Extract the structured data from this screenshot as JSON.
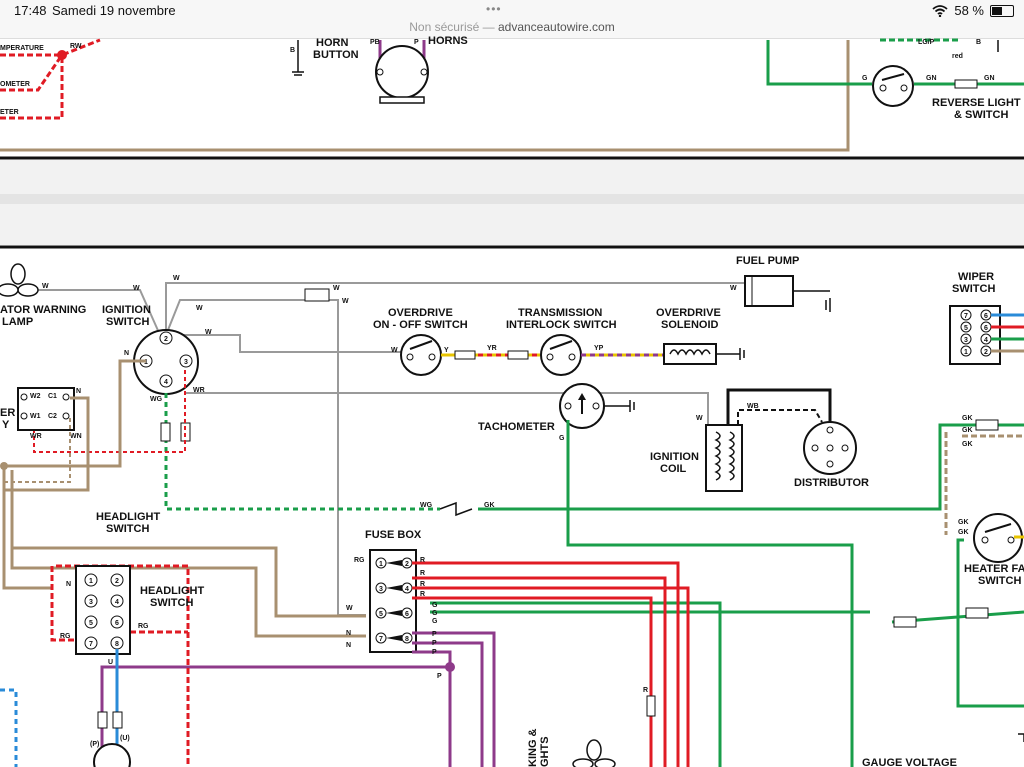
{
  "status_bar": {
    "time": "17:48",
    "date": "Samedi 19 novembre",
    "dots": "•••",
    "not_secure": "Non sécurisé —",
    "url": "advanceautowire.com",
    "battery": "58 %",
    "battery_level": 0.58,
    "wifi_icon": "wifi-icon",
    "battery_icon": "battery-icon"
  },
  "diagram": {
    "top_labels": {
      "temperature": "MPERATURE",
      "rw": "RW",
      "ometer": "OMETER",
      "eter": "ETER",
      "b": "B",
      "horn_button_1": "HORN",
      "horn_button_2": "BUTTON",
      "pb": "PB",
      "p": "P",
      "horns": "HORNS",
      "lgp": "LG/P",
      "b2": "B",
      "red": "red",
      "g": "G",
      "gn1": "GN",
      "gn2": "GN",
      "reverse_1": "REVERSE LIGHT",
      "reverse_2": "& SWITCH"
    },
    "components": {
      "warning_lamp_1": "ATOR WARNING",
      "warning_lamp_2": "LAMP",
      "ignition_switch_1": "IGNITION",
      "ignition_switch_2": "SWITCH",
      "fuel_pump": "FUEL PUMP",
      "overdrive_switch_1": "OVERDRIVE",
      "overdrive_switch_2": "ON - OFF SWITCH",
      "interlock_1": "TRANSMISSION",
      "interlock_2": "INTERLOCK SWITCH",
      "solenoid_1": "OVERDRIVE",
      "solenoid_2": "SOLENOID",
      "wiper_switch_1": "WIPER",
      "wiper_switch_2": "SWITCH",
      "tachometer": "TACHOMETER",
      "ignition_coil_1": "IGNITION",
      "ignition_coil_2": "COIL",
      "distributor": "DISTRIBUTOR",
      "headlight_switch_left_1": "HEADLIGHT",
      "headlight_switch_left_2": "SWITCH",
      "fuse_box": "FUSE BOX",
      "headlight_switch_1": "HEADLIGHT",
      "headlight_switch_2": "SWITCH",
      "heater_fan_1": "HEATER FA",
      "heater_fan_2": "SWITCH",
      "gauge_voltage": "GAUGE VOLTAGE",
      "parking_lights_1": "KING &",
      "parking_lights_2": "GHTS",
      "er": "ER",
      "y": "Y"
    },
    "wire_codes": {
      "w": "W",
      "n": "N",
      "wg": "WG",
      "wr": "WR",
      "wn": "WN",
      "y": "Y",
      "yr": "YR",
      "yp": "YP",
      "wb": "WB",
      "gk": "GK",
      "g": "G",
      "r": "R",
      "rg": "RG",
      "p": "P",
      "u": "U",
      "pu": "(P)",
      "uu": "(U)",
      "w2": "W2",
      "w1": "W1",
      "c1": "C1",
      "c2": "C2"
    },
    "pins": {
      "ign_1": "1",
      "ign_2": "2",
      "ign_3": "3",
      "ign_4": "4",
      "hs_1": "1",
      "hs_2": "2",
      "hs_3": "3",
      "hs_4": "4",
      "hs_5": "5",
      "hs_6": "6",
      "hs_7": "7",
      "hs_8": "8",
      "fb_1": "1",
      "fb_2": "2",
      "fb_3": "3",
      "fb_4": "4",
      "fb_5": "5",
      "fb_6": "6",
      "fb_7": "7",
      "fb_8": "8",
      "ws_7": "7",
      "ws_6": "6",
      "ws_5": "5",
      "ws_4": "4",
      "ws_3": "3",
      "ws_2": "2",
      "ws_1": "1"
    },
    "colors": {
      "tan": "#a89070",
      "red": "#e01b24",
      "green": "#1a9e4a",
      "purple": "#8e3a8a",
      "blue": "#2a8bd8",
      "yellow": "#e8c400",
      "black": "#111111",
      "grey": "#9a9a9a"
    }
  }
}
